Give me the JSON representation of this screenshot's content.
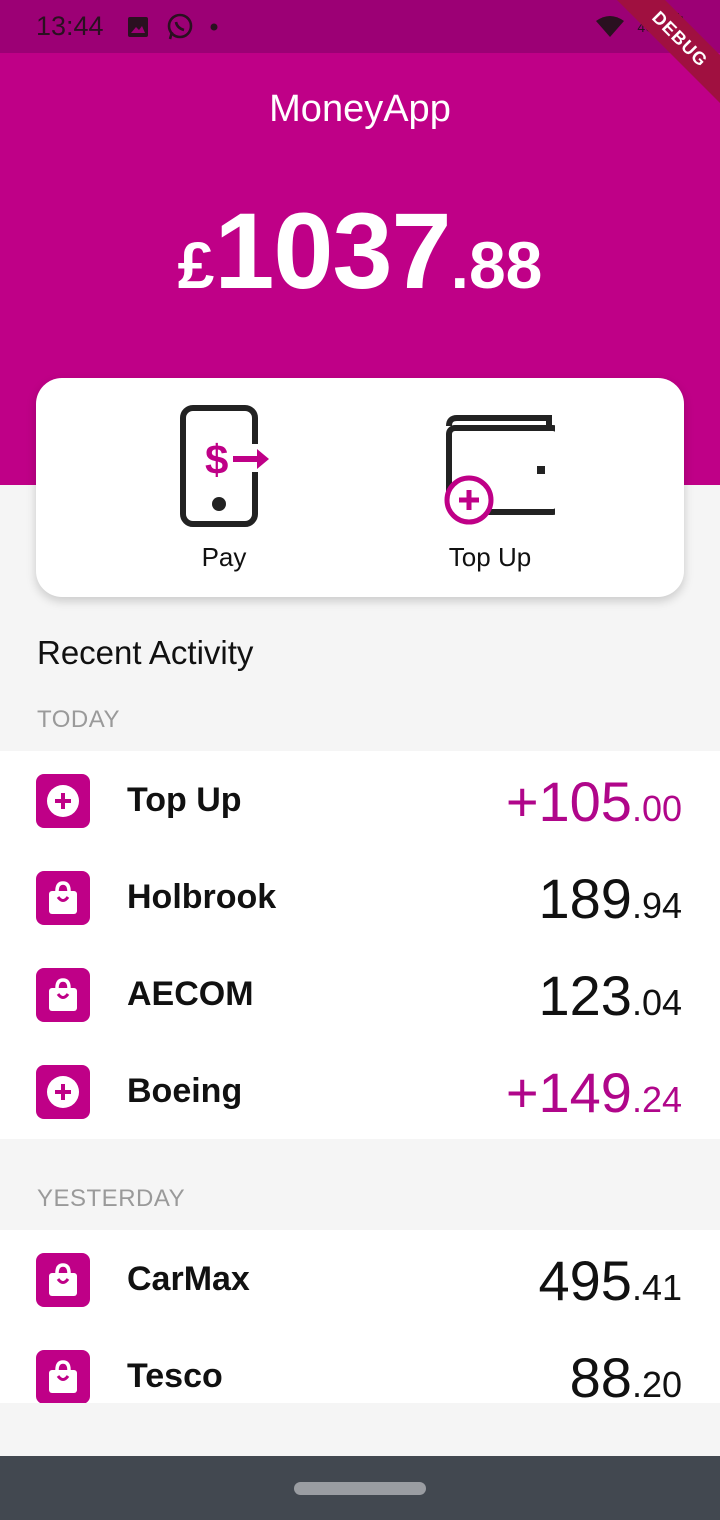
{
  "status_bar": {
    "time": "13:44",
    "network": "4G"
  },
  "debug_banner": "DEBUG",
  "header": {
    "title": "MoneyApp",
    "balance": {
      "currency": "£",
      "major": "1037",
      "minor": ".88"
    }
  },
  "actions": {
    "pay_label": "Pay",
    "topup_label": "Top Up"
  },
  "recent_activity": {
    "title": "Recent Activity",
    "groups": [
      {
        "label": "TODAY",
        "items": [
          {
            "icon": "plus-circle-icon",
            "name": "Top Up",
            "amount_major": "+105",
            "amount_minor": ".00",
            "credit": true
          },
          {
            "icon": "shopping-bag-icon",
            "name": "Holbrook",
            "amount_major": "189",
            "amount_minor": ".94",
            "credit": false
          },
          {
            "icon": "shopping-bag-icon",
            "name": "AECOM",
            "amount_major": "123",
            "amount_minor": ".04",
            "credit": false
          },
          {
            "icon": "plus-circle-icon",
            "name": "Boeing",
            "amount_major": "+149",
            "amount_minor": ".24",
            "credit": true
          }
        ]
      },
      {
        "label": "YESTERDAY",
        "items": [
          {
            "icon": "shopping-bag-icon",
            "name": "CarMax",
            "amount_major": "495",
            "amount_minor": ".41",
            "credit": false
          },
          {
            "icon": "shopping-bag-icon",
            "name": "Tesco",
            "amount_major": "88",
            "amount_minor": ".20",
            "credit": false
          }
        ]
      }
    ]
  },
  "colors": {
    "brand": "#bf0087",
    "status_bar": "#9c0075",
    "credit": "#b0068a",
    "nav_bar": "#424850"
  }
}
